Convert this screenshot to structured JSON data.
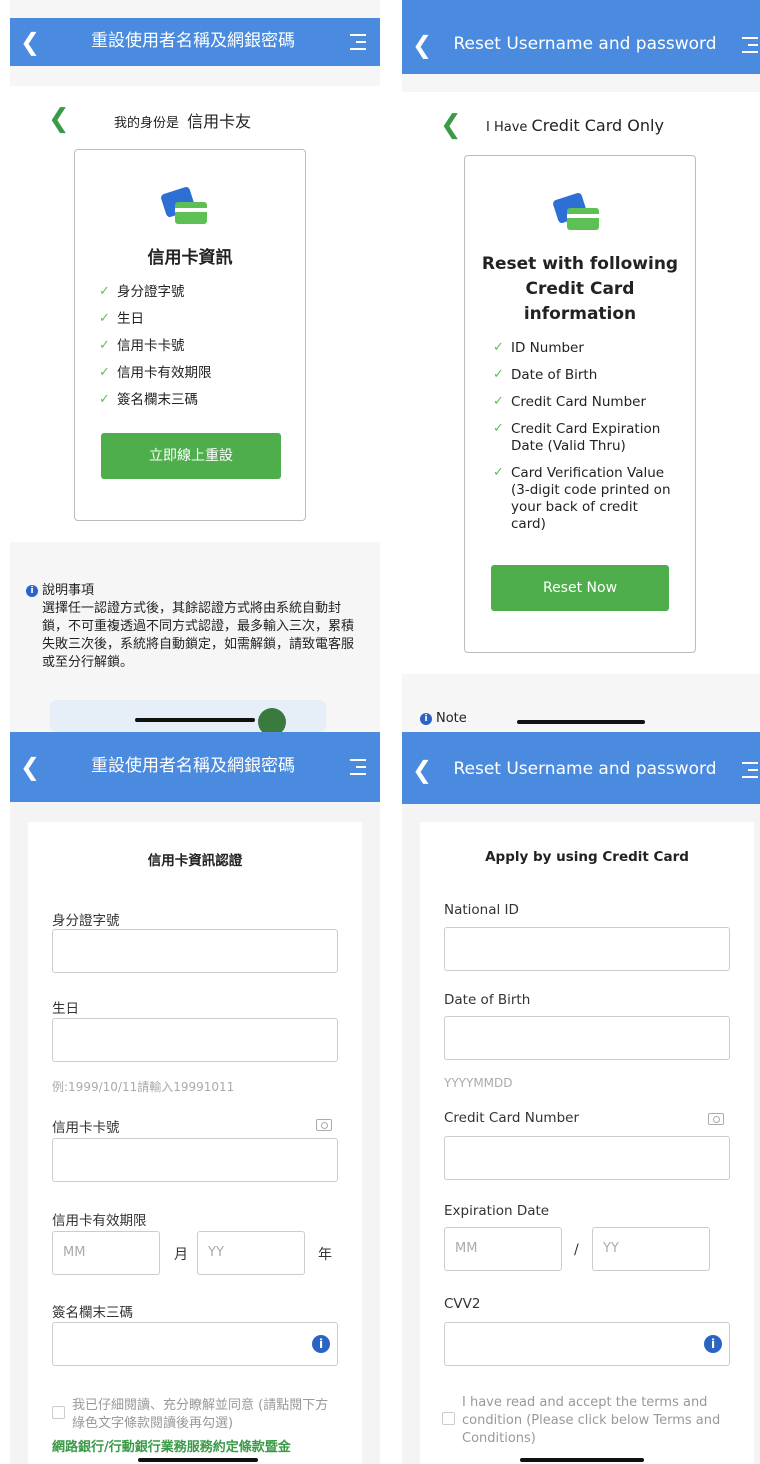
{
  "zh_header": {
    "title": "重設使用者名稱及網銀密碼"
  },
  "en_header": {
    "title": "Reset Username and password"
  },
  "zh_intro": {
    "identity_prefix": "我的身份是",
    "identity_value": "信用卡友",
    "card_title": "信用卡資訊",
    "items": [
      "身分證字號",
      "生日",
      "信用卡卡號",
      "信用卡有效期限",
      "簽名欄末三碼"
    ],
    "button": "立即線上重設",
    "note_title": "說明事項",
    "note_body": "選擇任一認證方式後，其餘認證方式將由系統自動封鎖，不可重複透過不同方式認證，最多輸入三次，累積失敗三次後，系統將自動鎖定，如需解鎖，請致電客服或至分行解鎖。"
  },
  "en_intro": {
    "identity_prefix": "I Have",
    "identity_value": "Credit Card Only",
    "card_title": "Reset with following Credit Card information",
    "items": [
      "ID Number",
      "Date of Birth",
      "Credit Card Number",
      "Credit Card Expiration Date (Valid Thru)",
      "Card Verification Value (3-digit code printed on your back of credit card)"
    ],
    "button": "Reset Now",
    "note_title": "Note"
  },
  "zh_form": {
    "title": "信用卡資訊認證",
    "id_label": "身分證字號",
    "dob_label": "生日",
    "dob_hint": "例:1999/10/11請輸入19991011",
    "card_label": "信用卡卡號",
    "exp_label": "信用卡有效期限",
    "mm_placeholder": "MM",
    "month_unit": "月",
    "yy_placeholder": "YY",
    "year_unit": "年",
    "cvv_label": "簽名欄末三碼",
    "terms": "我已仔細閱讀、充分瞭解並同意 (請點閱下方綠色文字條款閱讀後再勾選)",
    "terms_link": "網路銀行/行動銀行業務服務約定條款暨金"
  },
  "en_form": {
    "title": "Apply by using Credit Card",
    "id_label": "National ID",
    "dob_label": "Date of Birth",
    "dob_hint": "YYYYMMDD",
    "card_label": "Credit Card Number",
    "exp_label": "Expiration Date",
    "mm_placeholder": "MM",
    "separator": "/",
    "yy_placeholder": "YY",
    "cvv_label": "CVV2",
    "terms": "I have read and accept the terms and condition (Please click below Terms and Conditions)"
  },
  "colors": {
    "header": "#4a8be0",
    "green": "#4fae4c",
    "info_blue": "#2a64c4"
  }
}
